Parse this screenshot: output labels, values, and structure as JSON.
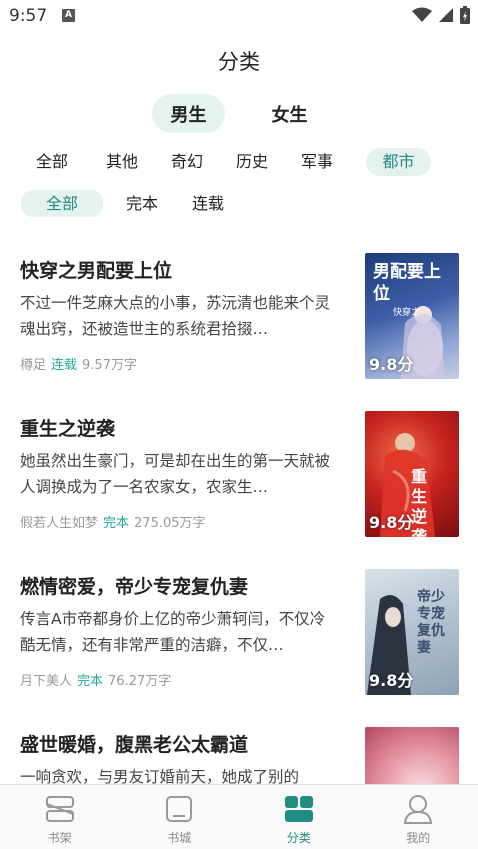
{
  "status_bar": {
    "time": "9:57",
    "notif_icon": "A"
  },
  "header": {
    "title": "分类"
  },
  "gender_tabs": [
    {
      "label": "男生",
      "active": true
    },
    {
      "label": "女生",
      "active": false
    }
  ],
  "categories": [
    {
      "label": "全部"
    },
    {
      "label": "其他"
    },
    {
      "label": "奇幻"
    },
    {
      "label": "历史"
    },
    {
      "label": "军事"
    },
    {
      "label": "都市",
      "active": true
    }
  ],
  "status_filters": [
    {
      "label": "全部",
      "active": true
    },
    {
      "label": "完本"
    },
    {
      "label": "连载"
    }
  ],
  "books": [
    {
      "title": "快穿之男配要上位",
      "desc": "不过一件芝麻大点的小事，苏沅清也能来个灵魂出窍，还被造世主的系统君拾掇…",
      "author": "樽足",
      "status": "连载",
      "words": "9.57万字",
      "score": "9.8分",
      "cover_text": "男配要上位",
      "cover_sub": "快穿之"
    },
    {
      "title": "重生之逆袭",
      "desc": "她虽然出生豪门，可是却在出生的第一天就被人调换成为了一名农家女，农家生…",
      "author": "假若人生如梦",
      "status": "完本",
      "words": "275.05万字",
      "score": "9.8分",
      "cover_text": "重生逆袭",
      "cover_sub": ""
    },
    {
      "title": "燃情密爱，帝少专宠复仇妻",
      "desc": "传言A市帝都身价上亿的帝少萧轲闫，不仅冷酷无情，还有非常严重的洁癖，不仅…",
      "author": "月下美人",
      "status": "完本",
      "words": "76.27万字",
      "score": "9.8分",
      "cover_text": "帝少专宠复仇妻",
      "cover_sub": ""
    },
    {
      "title": "盛世暖婚，腹黑老公太霸道",
      "desc": "一响贪欢，与男友订婚前天，她成了别的",
      "author": "",
      "status": "",
      "words": "",
      "score": "",
      "cover_text": "",
      "cover_sub": ""
    }
  ],
  "bottom_nav": [
    {
      "label": "书架",
      "icon": "bookshelf-icon"
    },
    {
      "label": "书城",
      "icon": "bookstore-icon"
    },
    {
      "label": "分类",
      "icon": "category-icon",
      "active": true
    },
    {
      "label": "我的",
      "icon": "profile-icon"
    }
  ],
  "colors": {
    "accent": "#1f8d80",
    "accent_bg": "#e6f2ef",
    "serial": "#24a79b"
  }
}
